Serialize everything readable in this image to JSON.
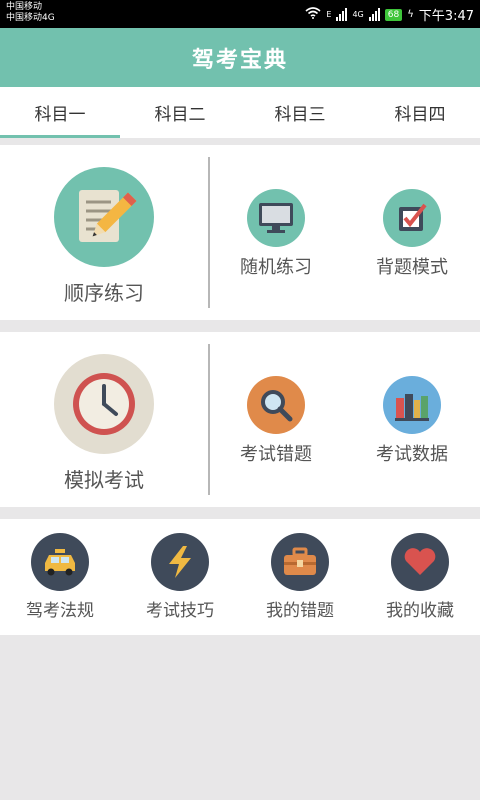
{
  "status": {
    "carrier1": "中国移动",
    "carrier2": "中国移动4G",
    "net_e": "E",
    "net_4g": "4G",
    "battery": "68",
    "time": "下午3:47"
  },
  "app": {
    "title": "驾考宝典"
  },
  "tabs": [
    {
      "label": "科目一",
      "active": true
    },
    {
      "label": "科目二"
    },
    {
      "label": "科目三"
    },
    {
      "label": "科目四"
    }
  ],
  "section1": {
    "main": "顺序练习",
    "a": "随机练习",
    "b": "背题模式"
  },
  "section2": {
    "main": "模拟考试",
    "a": "考试错题",
    "b": "考试数据"
  },
  "section3": {
    "items": [
      "驾考法规",
      "考试技巧",
      "我的错题",
      "我的收藏"
    ]
  },
  "colors": {
    "accent": "#72c1ae",
    "dark_icon_bg": "#3f4a5a",
    "orange": "#e08a4a",
    "blue": "#6aaedc"
  },
  "icons": {
    "sequential": "notepad-pencil-icon",
    "random": "monitor-icon",
    "memorize": "checkbox-icon",
    "mock": "clock-icon",
    "wrong": "magnifier-icon",
    "data": "books-icon",
    "rules": "car-icon",
    "tips": "lightning-icon",
    "my_wrong": "briefcase-icon",
    "favorites": "heart-icon"
  }
}
